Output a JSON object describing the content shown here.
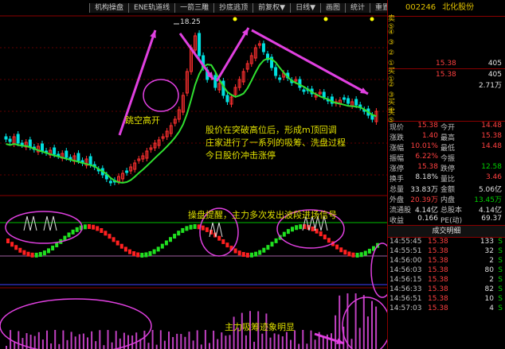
{
  "toolbar": [
    "机构操盘",
    "ENE轨道线",
    "一箭三雕",
    "抄底逃顶",
    "前复权▼",
    "日线▼",
    "画图",
    "统计",
    "重置K线"
  ],
  "high_label": "18.25",
  "annotations": {
    "gap": "跳空高开",
    "line1": "股价在突破高位后，形成m顶回调",
    "line2": "庄家进行了一系列的吸筹、洗盘过程",
    "line3": "今日股价冲击涨停",
    "signal": "操盘提醒，主力多次发出波段进场信号",
    "volume": "主力吸筹迹象明显"
  },
  "stock": {
    "code": "002246",
    "name": "北化股份"
  },
  "orderbook": [
    {
      "label": "卖⑤",
      "price": "",
      "vol": ""
    },
    {
      "label": "④",
      "price": "",
      "vol": ""
    },
    {
      "label": "③",
      "price": "",
      "vol": ""
    },
    {
      "label": "②",
      "price": "",
      "vol": ""
    },
    {
      "label": "①",
      "price": "15.38",
      "vol": "405"
    },
    {
      "label": "买①",
      "price": "15.38",
      "vol": "405"
    },
    {
      "label": "②",
      "price": "",
      "vol": "2.71万"
    },
    {
      "label": "③",
      "price": "",
      "vol": ""
    },
    {
      "label": "买④",
      "price": "",
      "vol": ""
    },
    {
      "label": "买⑤",
      "price": "",
      "vol": ""
    }
  ],
  "quote": [
    {
      "l1": "现价",
      "v1": "15.38",
      "c1": "red",
      "l2": "今开",
      "v2": "14.48",
      "c2": "red"
    },
    {
      "l1": "涨跌",
      "v1": "1.40",
      "c1": "red",
      "l2": "最高",
      "v2": "15.38",
      "c2": "red"
    },
    {
      "l1": "涨幅",
      "v1": "10.01%",
      "c1": "red",
      "l2": "最低",
      "v2": "14.48",
      "c2": "red"
    },
    {
      "l1": "振幅",
      "v1": "6.22%",
      "c1": "red",
      "l2": "今振",
      "v2": "",
      "c2": "red"
    },
    {
      "l1": "涨停",
      "v1": "15.38",
      "c1": "red",
      "l2": "跌停",
      "v2": "12.58",
      "c2": "green"
    },
    {
      "l1": "换手",
      "v1": "8.18%",
      "c1": "white",
      "l2": "量比",
      "v2": "3.46",
      "c2": "red"
    },
    {
      "l1": "总量",
      "v1": "33.83万",
      "c1": "white",
      "l2": "金额",
      "v2": "5.06亿",
      "c2": "white"
    },
    {
      "l1": "外盘",
      "v1": "20.39万",
      "c1": "red",
      "l2": "内盘",
      "v2": "13.45万",
      "c2": "green"
    },
    {
      "l1": "流通股",
      "v1": "4.14亿",
      "c1": "white",
      "l2": "总股本",
      "v2": "4.14亿",
      "c2": "white"
    },
    {
      "l1": "收益",
      "v1": "0.166",
      "c1": "white",
      "l2": "PE(动)",
      "v2": "69.37",
      "c2": "white"
    }
  ],
  "trades_title": "成交明细",
  "trades": [
    {
      "time": "14:55:45",
      "price": "15.38",
      "vol": "133",
      "dir": "S"
    },
    {
      "time": "14:55:51",
      "price": "15.38",
      "vol": "32",
      "dir": "S"
    },
    {
      "time": "14:56:00",
      "price": "15.38",
      "vol": "2",
      "dir": "S"
    },
    {
      "time": "14:56:03",
      "price": "15.38",
      "vol": "80",
      "dir": "S"
    },
    {
      "time": "14:56:15",
      "price": "15.38",
      "vol": "2",
      "dir": "S"
    },
    {
      "time": "14:56:33",
      "price": "15.38",
      "vol": "82",
      "dir": "S"
    },
    {
      "time": "14:56:51",
      "price": "15.38",
      "vol": "10",
      "dir": "S"
    },
    {
      "time": "14:57:03",
      "price": "15.38",
      "vol": "4",
      "dir": "S"
    }
  ]
}
